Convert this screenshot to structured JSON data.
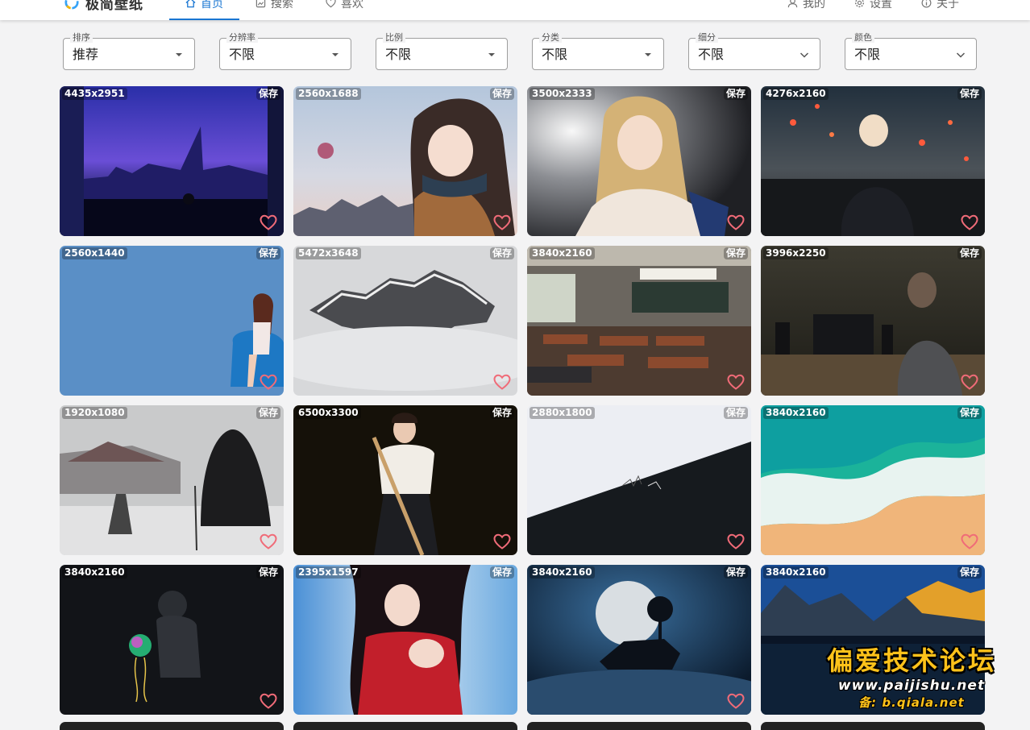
{
  "app": {
    "name": "极简壁纸"
  },
  "nav": {
    "tabs": [
      {
        "label": "首页",
        "icon": "home-icon",
        "active": true
      },
      {
        "label": "搜索",
        "icon": "search-image-icon",
        "active": false
      },
      {
        "label": "喜欢",
        "icon": "heart-outline-icon",
        "active": false
      }
    ],
    "right": [
      {
        "label": "我的",
        "icon": "user-icon"
      },
      {
        "label": "设置",
        "icon": "gear-icon"
      },
      {
        "label": "关于",
        "icon": "info-icon"
      }
    ]
  },
  "filters": [
    {
      "label": "排序",
      "value": "推荐"
    },
    {
      "label": "分辨率",
      "value": "不限"
    },
    {
      "label": "比例",
      "value": "不限"
    },
    {
      "label": "分类",
      "value": "不限"
    },
    {
      "label": "细分",
      "value": "不限"
    },
    {
      "label": "颜色",
      "value": "不限"
    }
  ],
  "wallpapers": [
    {
      "resolution": "4435x2951",
      "save": "保存",
      "subject": "city-night-window"
    },
    {
      "resolution": "2560x1688",
      "save": "保存",
      "subject": "anime-girl-scarf"
    },
    {
      "resolution": "3500x2333",
      "save": "保存",
      "subject": "anime-girl-blonde"
    },
    {
      "resolution": "4276x2160",
      "save": "保存",
      "subject": "sky-lanterns"
    },
    {
      "resolution": "2560x1440",
      "save": "保存",
      "subject": "girl-blue-chair"
    },
    {
      "resolution": "5472x3648",
      "save": "保存",
      "subject": "misty-mountain"
    },
    {
      "resolution": "3840x2160",
      "save": "保存",
      "subject": "classroom"
    },
    {
      "resolution": "3996x2250",
      "save": "保存",
      "subject": "desk-night"
    },
    {
      "resolution": "1920x1080",
      "save": "保存",
      "subject": "snow-samurai"
    },
    {
      "resolution": "6500x3300",
      "save": "保存",
      "subject": "kendo-girl"
    },
    {
      "resolution": "2880x1800",
      "save": "保存",
      "subject": "life-death"
    },
    {
      "resolution": "3840x2160",
      "save": "保存",
      "subject": "beach-waves"
    },
    {
      "resolution": "3840x2160",
      "save": "保存",
      "subject": "astronaut-jellyfish"
    },
    {
      "resolution": "2395x1597",
      "save": "保存",
      "subject": "anime-warrior-red"
    },
    {
      "resolution": "3840x2160",
      "save": "保存",
      "subject": "moon-island"
    },
    {
      "resolution": "3840x2160",
      "save": "保存",
      "subject": "mountain-lake"
    }
  ],
  "watermark": {
    "title": "偏爱技术论坛",
    "url": "www.paijishu.net",
    "backup": "备: b.qiala.net"
  },
  "colors": {
    "accent": "#1976d2",
    "heart": "#f06b78",
    "watermark": "#ffc21a"
  }
}
